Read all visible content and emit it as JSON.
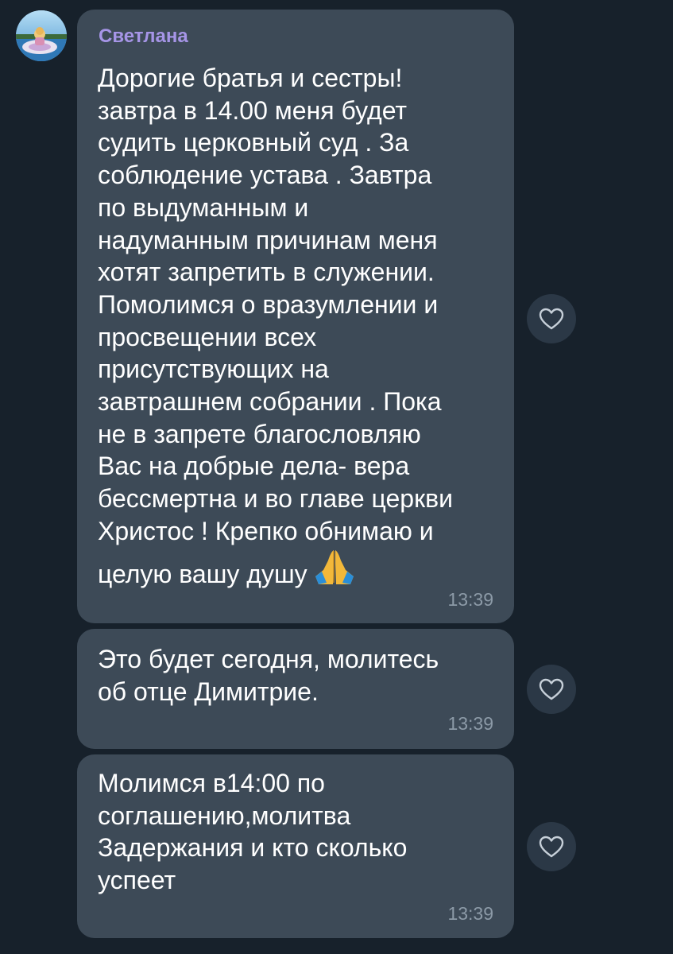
{
  "sender": {
    "name": "Светлана"
  },
  "messages": [
    {
      "text": "Дорогие братья и сестры!\nзавтра в 14.00 меня будет\nсудить церковный суд . За\nсоблюдение устава . Завтра\nпо выдуманным и\nнадуманным причинам меня\nхотят запретить в служении.\nПомолимся о вразумлении и\nпросвещении всех\nприсутствующих на\nзавтрашнем собрании . Пока\nне в запрете благословляю\nВас на добрые дела- вера\nбессмертна и во главе церкви\nХристос ! Крепко обнимаю и\nцелую вашу душу",
      "emoji": "folded-hands",
      "time": "13:39"
    },
    {
      "text": "Это будет сегодня, молитесь\nоб отце Димитрие.",
      "time": "13:39"
    },
    {
      "text": "Молимся в14:00 по\nсоглашению,молитва\nЗадержания и кто сколько\nуспеет",
      "time": "13:39"
    }
  ],
  "icons": {
    "reaction": "heart-outline-icon"
  },
  "colors": {
    "background": "#17212b",
    "bubble": "#3d4a57",
    "sender_name": "#a695e7",
    "time": "#8c9aa7",
    "reaction_button": "#2b3846"
  }
}
